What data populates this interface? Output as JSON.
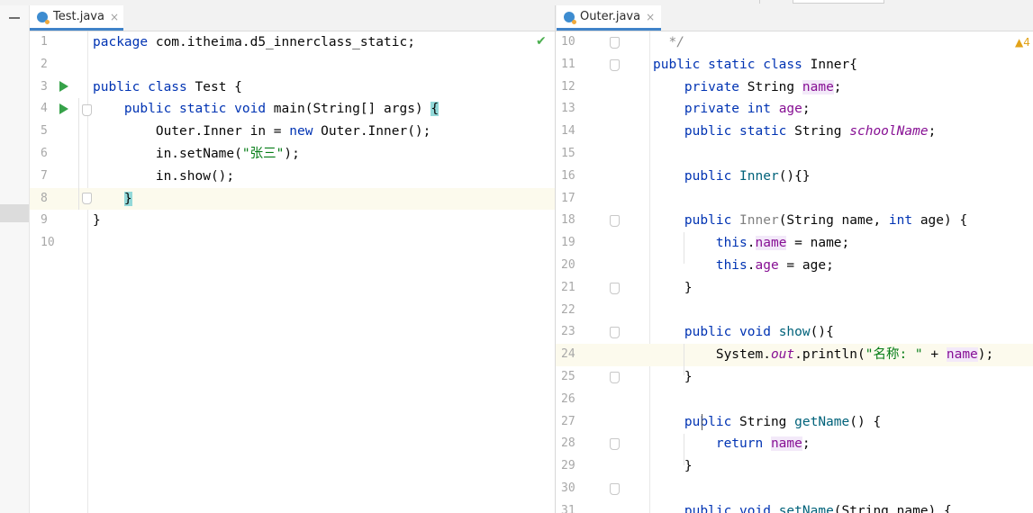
{
  "left_editor": {
    "tab": {
      "label": "Test.java",
      "close": "×",
      "icon": "java-class-icon"
    },
    "lines": [
      {
        "n": "1",
        "tokens": [
          {
            "t": "package ",
            "c": "kw"
          },
          {
            "t": "com.itheima.d5_innerclass_static;",
            "c": ""
          }
        ]
      },
      {
        "n": "2",
        "tokens": []
      },
      {
        "n": "3",
        "tokens": [
          {
            "t": "public class ",
            "c": "kw"
          },
          {
            "t": "Test {",
            "c": ""
          }
        ]
      },
      {
        "n": "4",
        "tokens": [
          {
            "t": "    public static void ",
            "c": "kw"
          },
          {
            "t": "main(String[] args) ",
            "c": ""
          },
          {
            "t": "{",
            "c": "brace-match"
          }
        ]
      },
      {
        "n": "5",
        "tokens": [
          {
            "t": "        Outer.Inner in = ",
            "c": ""
          },
          {
            "t": "new ",
            "c": "kw"
          },
          {
            "t": "Outer.Inner();",
            "c": ""
          }
        ]
      },
      {
        "n": "6",
        "tokens": [
          {
            "t": "        in.setName(",
            "c": ""
          },
          {
            "t": "\"张三\"",
            "c": "str"
          },
          {
            "t": ");",
            "c": ""
          }
        ]
      },
      {
        "n": "7",
        "tokens": [
          {
            "t": "        in.show();",
            "c": ""
          }
        ]
      },
      {
        "n": "8",
        "tokens": [
          {
            "t": "    ",
            "c": ""
          },
          {
            "t": "}",
            "c": "brace-match"
          }
        ]
      },
      {
        "n": "9",
        "tokens": [
          {
            "t": "}",
            "c": ""
          }
        ]
      },
      {
        "n": "10",
        "tokens": []
      }
    ]
  },
  "right_editor": {
    "tab": {
      "label": "Outer.java",
      "close": "×",
      "icon": "java-class-icon"
    },
    "warning_count": "4",
    "lines": [
      {
        "n": "10",
        "tokens": [
          {
            "t": "  */",
            "c": "cmt"
          }
        ]
      },
      {
        "n": "11",
        "tokens": [
          {
            "t": "public static class ",
            "c": "kw"
          },
          {
            "t": "Inner{",
            "c": ""
          }
        ]
      },
      {
        "n": "12",
        "tokens": [
          {
            "t": "    private ",
            "c": "kw"
          },
          {
            "t": "String ",
            "c": ""
          },
          {
            "t": "name",
            "c": "fld"
          },
          {
            "t": ";",
            "c": ""
          }
        ]
      },
      {
        "n": "13",
        "tokens": [
          {
            "t": "    private int ",
            "c": "kw"
          },
          {
            "t": "age",
            "c": "fldp"
          },
          {
            "t": ";",
            "c": ""
          }
        ]
      },
      {
        "n": "14",
        "tokens": [
          {
            "t": "    public static ",
            "c": "kw"
          },
          {
            "t": "String ",
            "c": ""
          },
          {
            "t": "schoolName",
            "c": "sfld"
          },
          {
            "t": ";",
            "c": ""
          }
        ]
      },
      {
        "n": "15",
        "tokens": []
      },
      {
        "n": "16",
        "tokens": [
          {
            "t": "    public ",
            "c": "kw"
          },
          {
            "t": "Inner",
            "c": "mth"
          },
          {
            "t": "(){}",
            "c": ""
          }
        ]
      },
      {
        "n": "17",
        "tokens": []
      },
      {
        "n": "18",
        "tokens": [
          {
            "t": "    public ",
            "c": "kw"
          },
          {
            "t": "Inner",
            "c": "unused"
          },
          {
            "t": "(String name, ",
            "c": ""
          },
          {
            "t": "int ",
            "c": "kw"
          },
          {
            "t": "age) {",
            "c": ""
          }
        ]
      },
      {
        "n": "19",
        "tokens": [
          {
            "t": "        this",
            "c": "kw"
          },
          {
            "t": ".",
            "c": ""
          },
          {
            "t": "name",
            "c": "fld"
          },
          {
            "t": " = name;",
            "c": ""
          }
        ]
      },
      {
        "n": "20",
        "tokens": [
          {
            "t": "        this",
            "c": "kw"
          },
          {
            "t": ".",
            "c": ""
          },
          {
            "t": "age",
            "c": "fldp"
          },
          {
            "t": " = age;",
            "c": ""
          }
        ]
      },
      {
        "n": "21",
        "tokens": [
          {
            "t": "    }",
            "c": ""
          }
        ]
      },
      {
        "n": "22",
        "tokens": []
      },
      {
        "n": "23",
        "tokens": [
          {
            "t": "    public void ",
            "c": "kw"
          },
          {
            "t": "show",
            "c": "mth"
          },
          {
            "t": "(){",
            "c": ""
          }
        ]
      },
      {
        "n": "24",
        "tokens": [
          {
            "t": "        System.",
            "c": ""
          },
          {
            "t": "out",
            "c": "sfld"
          },
          {
            "t": ".println(",
            "c": ""
          },
          {
            "t": "\"名称: \"",
            "c": "str"
          },
          {
            "t": " + ",
            "c": ""
          },
          {
            "t": "name",
            "c": "fld"
          },
          {
            "t": ");",
            "c": ""
          }
        ]
      },
      {
        "n": "25",
        "tokens": [
          {
            "t": "    }",
            "c": ""
          }
        ]
      },
      {
        "n": "26",
        "tokens": []
      },
      {
        "n": "27",
        "tokens": [
          {
            "t": "    public ",
            "c": "kw"
          },
          {
            "t": "String ",
            "c": ""
          },
          {
            "t": "getName",
            "c": "mth"
          },
          {
            "t": "() {",
            "c": ""
          }
        ]
      },
      {
        "n": "28",
        "tokens": [
          {
            "t": "        return ",
            "c": "kw"
          },
          {
            "t": "name",
            "c": "fld"
          },
          {
            "t": ";",
            "c": ""
          }
        ]
      },
      {
        "n": "29",
        "tokens": [
          {
            "t": "    }",
            "c": ""
          }
        ]
      },
      {
        "n": "30",
        "tokens": []
      },
      {
        "n": "31",
        "tokens": [
          {
            "t": "    public void ",
            "c": "kw"
          },
          {
            "t": "setName",
            "c": "mth"
          },
          {
            "t": "(String name) {",
            "c": ""
          }
        ]
      }
    ]
  }
}
